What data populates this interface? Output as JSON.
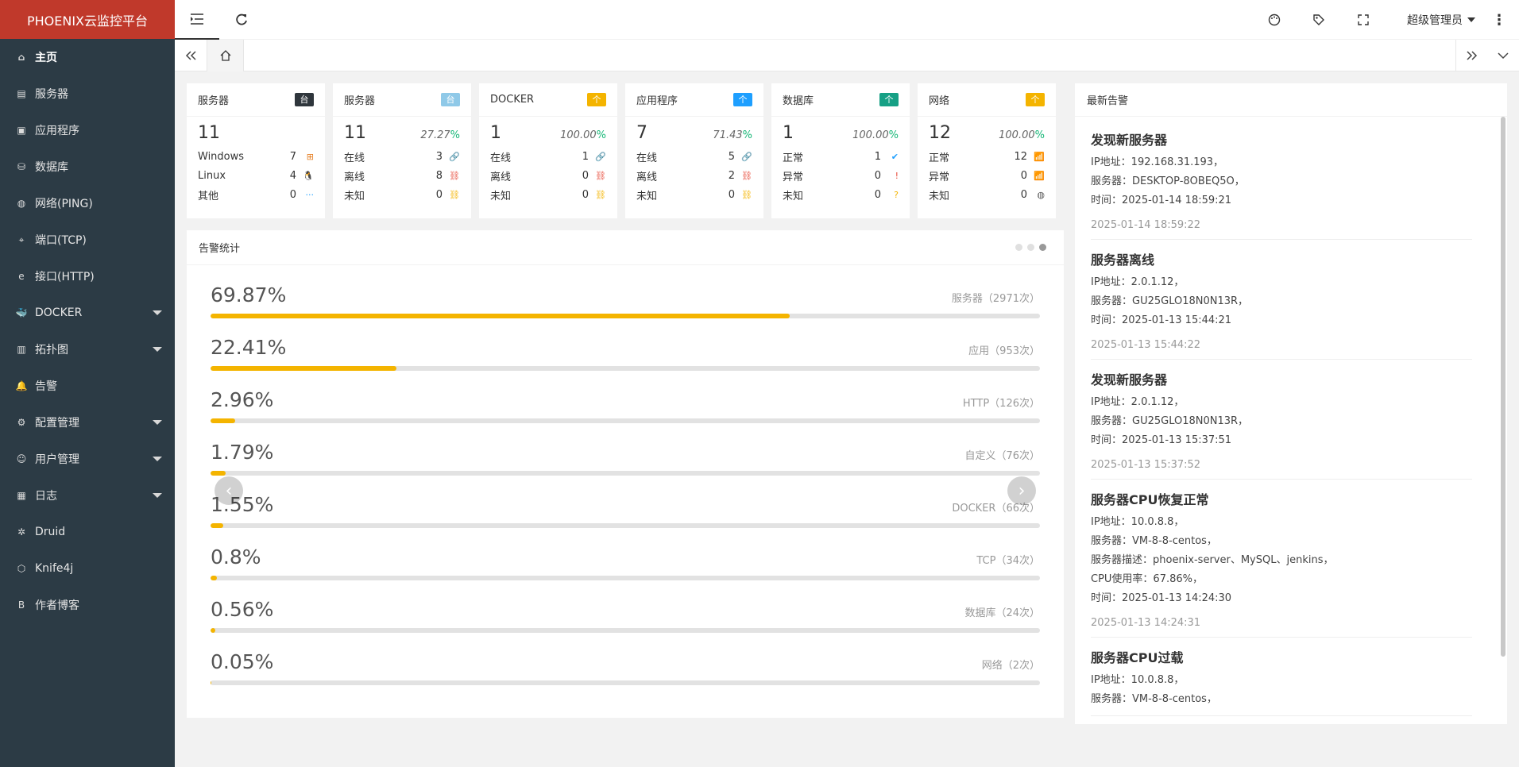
{
  "app": {
    "title": "PHOENIX云监控平台"
  },
  "sidebar": {
    "items": [
      {
        "label": "主页",
        "icon": "home-icon",
        "active": true,
        "caret": false
      },
      {
        "label": "服务器",
        "icon": "server-icon",
        "caret": false
      },
      {
        "label": "应用程序",
        "icon": "app-icon",
        "caret": false
      },
      {
        "label": "数据库",
        "icon": "database-icon",
        "caret": false
      },
      {
        "label": "网络(PING)",
        "icon": "globe-icon",
        "caret": false
      },
      {
        "label": "端口(TCP)",
        "icon": "port-icon",
        "caret": false
      },
      {
        "label": "接口(HTTP)",
        "icon": "ie-icon",
        "caret": false
      },
      {
        "label": "DOCKER",
        "icon": "docker-icon",
        "caret": true
      },
      {
        "label": "拓扑图",
        "icon": "topology-icon",
        "caret": true
      },
      {
        "label": "告警",
        "icon": "bell-icon",
        "caret": false
      },
      {
        "label": "配置管理",
        "icon": "gear-icon",
        "caret": true
      },
      {
        "label": "用户管理",
        "icon": "user-icon",
        "caret": true
      },
      {
        "label": "日志",
        "icon": "log-icon",
        "caret": true
      },
      {
        "label": "Druid",
        "icon": "druid-icon",
        "caret": false
      },
      {
        "label": "Knife4j",
        "icon": "cube-icon",
        "caret": false
      },
      {
        "label": "作者博客",
        "icon": "blog-icon",
        "caret": false
      }
    ]
  },
  "header": {
    "user": "超级管理员"
  },
  "cards": [
    {
      "title": "服务器",
      "badge": "台",
      "badge_color": "#2f363c",
      "total": "11",
      "pct": "",
      "rows": [
        {
          "label": "Windows",
          "value": "7",
          "icon": "windows-icon",
          "glyph": "⊞",
          "color": "#e67e22"
        },
        {
          "label": "Linux",
          "value": "4",
          "icon": "linux-icon",
          "glyph": "🐧",
          "color": "#333"
        },
        {
          "label": "其他",
          "value": "0",
          "icon": "more-icon",
          "glyph": "···",
          "color": "#1e9fff"
        }
      ]
    },
    {
      "title": "服务器",
      "badge": "台",
      "badge_color": "#8fc9e8",
      "total": "11",
      "pct": "27.27",
      "rows": [
        {
          "label": "在线",
          "value": "3",
          "icon": "link-icon",
          "glyph": "🔗",
          "color": "#1e9fff"
        },
        {
          "label": "离线",
          "value": "8",
          "icon": "unlink-icon",
          "glyph": "⛓",
          "color": "#e74c3c"
        },
        {
          "label": "未知",
          "value": "0",
          "icon": "unknown-link-icon",
          "glyph": "⛓",
          "color": "#f4b400"
        }
      ]
    },
    {
      "title": "DOCKER",
      "badge": "个",
      "badge_color": "#f4b400",
      "total": "1",
      "pct": "100.00",
      "rows": [
        {
          "label": "在线",
          "value": "1",
          "icon": "link-icon",
          "glyph": "🔗",
          "color": "#1e9fff"
        },
        {
          "label": "离线",
          "value": "0",
          "icon": "unlink-icon",
          "glyph": "⛓",
          "color": "#e74c3c"
        },
        {
          "label": "未知",
          "value": "0",
          "icon": "unknown-link-icon",
          "glyph": "⛓",
          "color": "#f4b400"
        }
      ]
    },
    {
      "title": "应用程序",
      "badge": "个",
      "badge_color": "#1e9fff",
      "total": "7",
      "pct": "71.43",
      "rows": [
        {
          "label": "在线",
          "value": "5",
          "icon": "link-icon",
          "glyph": "🔗",
          "color": "#1e9fff"
        },
        {
          "label": "离线",
          "value": "2",
          "icon": "unlink-icon",
          "glyph": "⛓",
          "color": "#e74c3c"
        },
        {
          "label": "未知",
          "value": "0",
          "icon": "unknown-link-icon",
          "glyph": "⛓",
          "color": "#f4b400"
        }
      ]
    },
    {
      "title": "数据库",
      "badge": "个",
      "badge_color": "#16a085",
      "total": "1",
      "pct": "100.00",
      "rows": [
        {
          "label": "正常",
          "value": "1",
          "icon": "check-circle-icon",
          "glyph": "✔",
          "color": "#1e9fff"
        },
        {
          "label": "异常",
          "value": "0",
          "icon": "alert-circle-icon",
          "glyph": "!",
          "color": "#e74c3c"
        },
        {
          "label": "未知",
          "value": "0",
          "icon": "question-circle-icon",
          "glyph": "?",
          "color": "#f4b400"
        }
      ]
    },
    {
      "title": "网络",
      "badge": "个",
      "badge_color": "#f4b400",
      "total": "12",
      "pct": "100.00",
      "rows": [
        {
          "label": "正常",
          "value": "12",
          "icon": "wifi-icon",
          "glyph": "📶",
          "color": "#1e9fff"
        },
        {
          "label": "异常",
          "value": "0",
          "icon": "wifi-off-icon",
          "glyph": "📶",
          "color": "#e74c3c"
        },
        {
          "label": "未知",
          "value": "0",
          "icon": "globe-icon",
          "glyph": "◍",
          "color": "#555"
        }
      ]
    }
  ],
  "alarm_stats": {
    "title": "告警统计",
    "items": [
      {
        "pct": "69.87%",
        "value": 69.87,
        "label": "服务器（2971次）"
      },
      {
        "pct": "22.41%",
        "value": 22.41,
        "label": "应用（953次）"
      },
      {
        "pct": "2.96%",
        "value": 2.96,
        "label": "HTTP（126次）"
      },
      {
        "pct": "1.79%",
        "value": 1.79,
        "label": "自定义（76次）"
      },
      {
        "pct": "1.55%",
        "value": 1.55,
        "label": "DOCKER（66次）"
      },
      {
        "pct": "0.8%",
        "value": 0.8,
        "label": "TCP（34次）"
      },
      {
        "pct": "0.56%",
        "value": 0.56,
        "label": "数据库（24次）"
      },
      {
        "pct": "0.05%",
        "value": 0.05,
        "label": "网络（2次）"
      }
    ]
  },
  "latest_alarms": {
    "title": "最新告警",
    "items": [
      {
        "title": "发现新服务器",
        "lines": [
          "IP地址：192.168.31.193，",
          "服务器：DESKTOP-8OBEQ5O，",
          "时间：2025-01-14 18:59:21"
        ],
        "time": "2025-01-14 18:59:22"
      },
      {
        "title": "服务器离线",
        "lines": [
          "IP地址：2.0.1.12，",
          "服务器：GU25GLO18N0N13R，",
          "时间：2025-01-13 15:44:21"
        ],
        "time": "2025-01-13 15:44:22"
      },
      {
        "title": "发现新服务器",
        "lines": [
          "IP地址：2.0.1.12，",
          "服务器：GU25GLO18N0N13R，",
          "时间：2025-01-13 15:37:51"
        ],
        "time": "2025-01-13 15:37:52"
      },
      {
        "title": "服务器CPU恢复正常",
        "lines": [
          "IP地址：10.0.8.8，",
          "服务器：VM-8-8-centos，",
          "服务器描述：phoenix-server、MySQL、jenkins，",
          "CPU使用率：67.86%，",
          "时间：2025-01-13 14:24:30"
        ],
        "time": "2025-01-13 14:24:31"
      },
      {
        "title": "服务器CPU过载",
        "lines": [
          "IP地址：10.0.8.8，",
          "服务器：VM-8-8-centos，"
        ],
        "time": ""
      }
    ]
  }
}
